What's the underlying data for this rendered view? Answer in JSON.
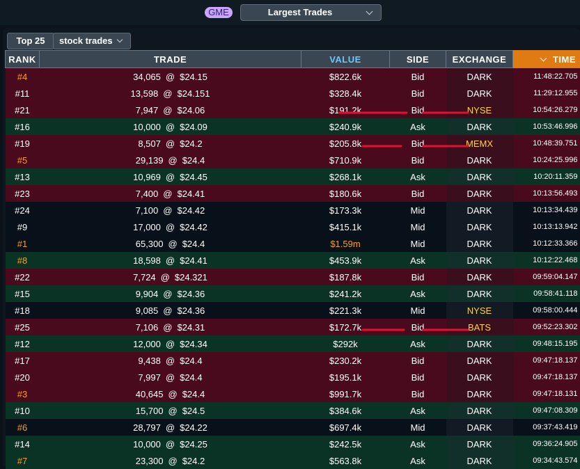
{
  "header": {
    "ticker": "GME",
    "view_select": "Largest Trades"
  },
  "controls": {
    "top_label": "Top 25",
    "type_select": "stock trades"
  },
  "columns": {
    "rank": "RANK",
    "trade": "TRADE",
    "value": "VALUE",
    "side": "SIDE",
    "exchange": "EXCHANGE",
    "time": "TIME"
  },
  "colors": {
    "bid_row": "#4a0a1e",
    "ask_row": "#0a3326",
    "mid_row": "#081019",
    "highlight_orange": "#f7a21b",
    "exchange_yellow": "#ffd23f",
    "sort_header": "#e07a12",
    "value_header": "#6ec6ff"
  },
  "rows": [
    {
      "rank": "#4",
      "shares": "34,065",
      "at": "@",
      "price": "$24.15",
      "value": "$822.6k",
      "side": "Bid",
      "exchange": "DARK",
      "time": "11:48:22.705",
      "rank_hl": true,
      "value_hl": false,
      "exch_hl": false
    },
    {
      "rank": "#11",
      "shares": "13,598",
      "at": "@",
      "price": "$24.151",
      "value": "$328.4k",
      "side": "Bid",
      "exchange": "DARK",
      "time": "11:29:12.955",
      "rank_hl": false,
      "value_hl": false,
      "exch_hl": false
    },
    {
      "rank": "#21",
      "shares": "7,947",
      "at": "@",
      "price": "$24.06",
      "value": "$191.2k",
      "side": "Bid",
      "exchange": "NYSE",
      "time": "10:54:26.279",
      "rank_hl": false,
      "value_hl": false,
      "exch_hl": true
    },
    {
      "rank": "#16",
      "shares": "10,000",
      "at": "@",
      "price": "$24.09",
      "value": "$240.9k",
      "side": "Ask",
      "exchange": "DARK",
      "time": "10:53:46.996",
      "rank_hl": false,
      "value_hl": false,
      "exch_hl": false
    },
    {
      "rank": "#19",
      "shares": "8,507",
      "at": "@",
      "price": "$24.2",
      "value": "$205.8k",
      "side": "Bid",
      "exchange": "MEMX",
      "time": "10:48:39.751",
      "rank_hl": false,
      "value_hl": false,
      "exch_hl": true
    },
    {
      "rank": "#5",
      "shares": "29,139",
      "at": "@",
      "price": "$24.4",
      "value": "$710.9k",
      "side": "Bid",
      "exchange": "DARK",
      "time": "10:24:25.996",
      "rank_hl": true,
      "value_hl": false,
      "exch_hl": false
    },
    {
      "rank": "#13",
      "shares": "10,969",
      "at": "@",
      "price": "$24.45",
      "value": "$268.1k",
      "side": "Ask",
      "exchange": "DARK",
      "time": "10:20:11.359",
      "rank_hl": false,
      "value_hl": false,
      "exch_hl": false
    },
    {
      "rank": "#23",
      "shares": "7,400",
      "at": "@",
      "price": "$24.41",
      "value": "$180.6k",
      "side": "Bid",
      "exchange": "DARK",
      "time": "10:13:56.493",
      "rank_hl": false,
      "value_hl": false,
      "exch_hl": false
    },
    {
      "rank": "#24",
      "shares": "7,100",
      "at": "@",
      "price": "$24.42",
      "value": "$173.3k",
      "side": "Mid",
      "exchange": "DARK",
      "time": "10:13:34.439",
      "rank_hl": false,
      "value_hl": false,
      "exch_hl": false
    },
    {
      "rank": "#9",
      "shares": "17,000",
      "at": "@",
      "price": "$24.42",
      "value": "$415.1k",
      "side": "Mid",
      "exchange": "DARK",
      "time": "10:13:13.942",
      "rank_hl": false,
      "value_hl": false,
      "exch_hl": false
    },
    {
      "rank": "#1",
      "shares": "65,300",
      "at": "@",
      "price": "$24.4",
      "value": "$1.59m",
      "side": "Mid",
      "exchange": "DARK",
      "time": "10:12:33.366",
      "rank_hl": true,
      "value_hl": true,
      "exch_hl": false
    },
    {
      "rank": "#8",
      "shares": "18,598",
      "at": "@",
      "price": "$24.41",
      "value": "$453.9k",
      "side": "Ask",
      "exchange": "DARK",
      "time": "10:12:22.468",
      "rank_hl": true,
      "value_hl": false,
      "exch_hl": false
    },
    {
      "rank": "#22",
      "shares": "7,724",
      "at": "@",
      "price": "$24.321",
      "value": "$187.8k",
      "side": "Bid",
      "exchange": "DARK",
      "time": "09:59:04.147",
      "rank_hl": false,
      "value_hl": false,
      "exch_hl": false
    },
    {
      "rank": "#15",
      "shares": "9,904",
      "at": "@",
      "price": "$24.36",
      "value": "$241.2k",
      "side": "Ask",
      "exchange": "DARK",
      "time": "09:58:41.118",
      "rank_hl": false,
      "value_hl": false,
      "exch_hl": false
    },
    {
      "rank": "#18",
      "shares": "9,085",
      "at": "@",
      "price": "$24.36",
      "value": "$221.3k",
      "side": "Mid",
      "exchange": "NYSE",
      "time": "09:58:00.444",
      "rank_hl": false,
      "value_hl": false,
      "exch_hl": true
    },
    {
      "rank": "#25",
      "shares": "7,106",
      "at": "@",
      "price": "$24.31",
      "value": "$172.7k",
      "side": "Bid",
      "exchange": "BATS",
      "time": "09:52:23.302",
      "rank_hl": false,
      "value_hl": false,
      "exch_hl": true
    },
    {
      "rank": "#12",
      "shares": "12,000",
      "at": "@",
      "price": "$24.34",
      "value": "$292k",
      "side": "Ask",
      "exchange": "DARK",
      "time": "09:48:15.195",
      "rank_hl": false,
      "value_hl": false,
      "exch_hl": false
    },
    {
      "rank": "#17",
      "shares": "9,438",
      "at": "@",
      "price": "$24.4",
      "value": "$230.2k",
      "side": "Bid",
      "exchange": "DARK",
      "time": "09:47:18.137",
      "rank_hl": false,
      "value_hl": false,
      "exch_hl": false
    },
    {
      "rank": "#20",
      "shares": "7,997",
      "at": "@",
      "price": "$24.4",
      "value": "$195.1k",
      "side": "Bid",
      "exchange": "DARK",
      "time": "09:47:18.137",
      "rank_hl": false,
      "value_hl": false,
      "exch_hl": false
    },
    {
      "rank": "#3",
      "shares": "40,645",
      "at": "@",
      "price": "$24.4",
      "value": "$991.7k",
      "side": "Bid",
      "exchange": "DARK",
      "time": "09:47:18.131",
      "rank_hl": true,
      "value_hl": false,
      "exch_hl": false
    },
    {
      "rank": "#10",
      "shares": "15,700",
      "at": "@",
      "price": "$24.5",
      "value": "$384.6k",
      "side": "Ask",
      "exchange": "DARK",
      "time": "09:47:08.309",
      "rank_hl": false,
      "value_hl": false,
      "exch_hl": false
    },
    {
      "rank": "#6",
      "shares": "28,797",
      "at": "@",
      "price": "$24.22",
      "value": "$697.4k",
      "side": "Mid",
      "exchange": "DARK",
      "time": "09:37:43.419",
      "rank_hl": true,
      "value_hl": false,
      "exch_hl": false
    },
    {
      "rank": "#14",
      "shares": "10,000",
      "at": "@",
      "price": "$24.25",
      "value": "$242.5k",
      "side": "Ask",
      "exchange": "DARK",
      "time": "09:36:24.905",
      "rank_hl": false,
      "value_hl": false,
      "exch_hl": false
    },
    {
      "rank": "#7",
      "shares": "23,300",
      "at": "@",
      "price": "$24.2",
      "value": "$563.8k",
      "side": "Ask",
      "exchange": "DARK",
      "time": "09:34:43.574",
      "rank_hl": true,
      "value_hl": false,
      "exch_hl": false
    }
  ],
  "annotations": {
    "marked_rows": [
      2,
      4,
      15
    ]
  }
}
